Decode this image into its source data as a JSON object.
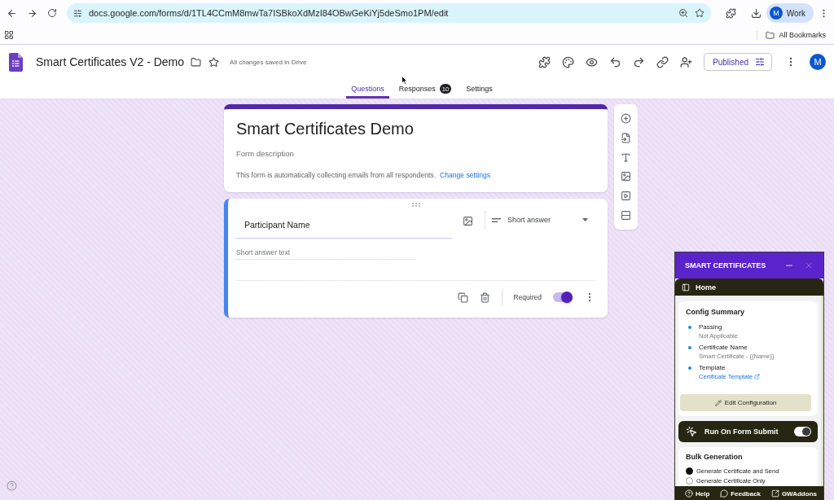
{
  "browser": {
    "url": "docs.google.com/forms/d/1TL4CCmM8mwTa7ISBkoXdMzI84OBwGeKiYj5deSmo1PM/edit",
    "profile": {
      "initial": "M",
      "label": "Work"
    },
    "bookmarks_bar": {
      "all_bookmarks": "All Bookmarks"
    }
  },
  "header": {
    "title": "Smart Certificates V2 - Demo",
    "starred": false,
    "save_status": "All changes saved in Drive",
    "publish_button": "Published",
    "avatar_initial": "M"
  },
  "tabs": [
    {
      "label": "Questions",
      "selected": true
    },
    {
      "label": "Responses",
      "selected": false,
      "badge": "10"
    },
    {
      "label": "Settings",
      "selected": false
    }
  ],
  "form": {
    "title": "Smart Certificates Demo",
    "description": {
      "placeholder": "Form description"
    },
    "email_notice": "This form is automatically collecting emails from all respondents.",
    "email_notice_link": "Change settings"
  },
  "question": {
    "title": "Participant Name",
    "type": "Short answer",
    "answer": {
      "placeholder": "Short answer text"
    },
    "required_label": "Required",
    "required": true
  },
  "addon_panel": {
    "title": "SMART CERTIFICATES",
    "nav": "Home",
    "config_summary": {
      "heading": "Config Summary",
      "items": [
        {
          "label": "Passing",
          "value": "Not Applicable",
          "kind": "text"
        },
        {
          "label": "Certificate Name",
          "value": "Smart Certificate - {{Name}}",
          "kind": "text"
        },
        {
          "label": "Template",
          "value": "Certificate Template",
          "kind": "link"
        }
      ],
      "edit_button": "Edit Configuration"
    },
    "run_on_submit": {
      "label": "Run On Form Submit",
      "on": true
    },
    "bulk_generation": {
      "heading": "Bulk Generation",
      "options": [
        {
          "label": "Generate Certificate and Send",
          "selected": true
        },
        {
          "label": "Generate Certificate Only",
          "selected": false
        }
      ]
    },
    "footer_links": [
      {
        "label": "Help",
        "kind": "help"
      },
      {
        "label": "Feedback",
        "kind": "feedback"
      },
      {
        "label": "GWAddons",
        "kind": "external"
      }
    ]
  }
}
